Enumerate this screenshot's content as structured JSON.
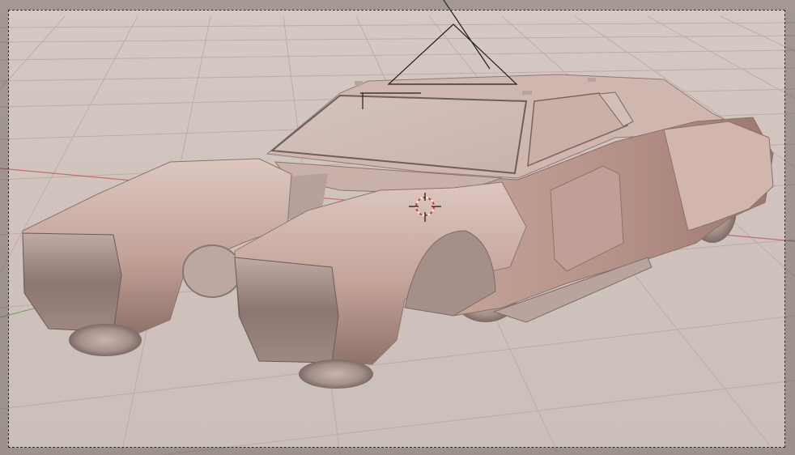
{
  "viewport": {
    "mode": "camera-view",
    "shading": "solid",
    "background_color": "#d3c6c1",
    "grid_color": "#b7a8a3",
    "x_axis_color": "#c4504f",
    "y_axis_color": "#6f9a4a",
    "object_color": "#cfb2a9"
  },
  "objects": {
    "car": "car-body-model",
    "camera": "camera-gizmo",
    "cursor": "3d-cursor-icon"
  }
}
